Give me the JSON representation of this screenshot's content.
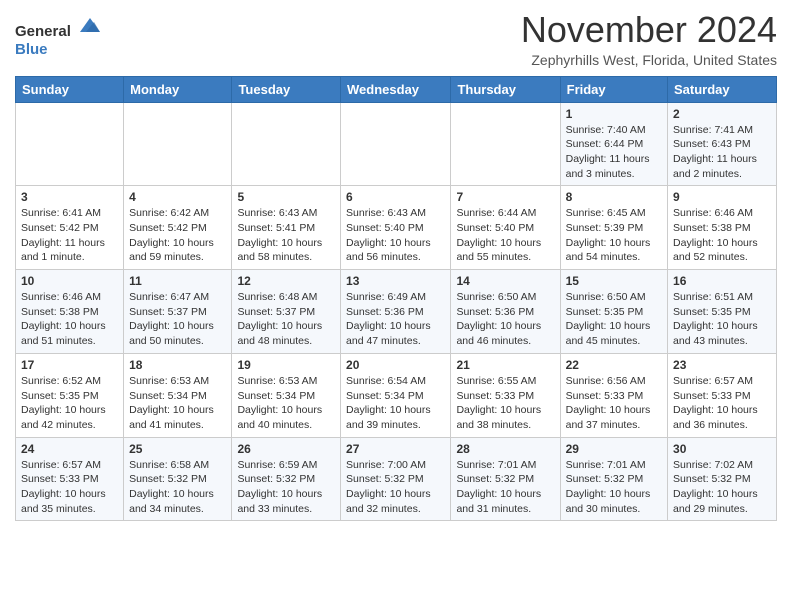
{
  "header": {
    "logo_general": "General",
    "logo_blue": "Blue",
    "month_title": "November 2024",
    "subtitle": "Zephyrhills West, Florida, United States"
  },
  "calendar": {
    "days_of_week": [
      "Sunday",
      "Monday",
      "Tuesday",
      "Wednesday",
      "Thursday",
      "Friday",
      "Saturday"
    ],
    "weeks": [
      [
        {
          "day": "",
          "content": ""
        },
        {
          "day": "",
          "content": ""
        },
        {
          "day": "",
          "content": ""
        },
        {
          "day": "",
          "content": ""
        },
        {
          "day": "",
          "content": ""
        },
        {
          "day": "1",
          "content": "Sunrise: 7:40 AM\nSunset: 6:44 PM\nDaylight: 11 hours and 3 minutes."
        },
        {
          "day": "2",
          "content": "Sunrise: 7:41 AM\nSunset: 6:43 PM\nDaylight: 11 hours and 2 minutes."
        }
      ],
      [
        {
          "day": "3",
          "content": "Sunrise: 6:41 AM\nSunset: 5:42 PM\nDaylight: 11 hours and 1 minute."
        },
        {
          "day": "4",
          "content": "Sunrise: 6:42 AM\nSunset: 5:42 PM\nDaylight: 10 hours and 59 minutes."
        },
        {
          "day": "5",
          "content": "Sunrise: 6:43 AM\nSunset: 5:41 PM\nDaylight: 10 hours and 58 minutes."
        },
        {
          "day": "6",
          "content": "Sunrise: 6:43 AM\nSunset: 5:40 PM\nDaylight: 10 hours and 56 minutes."
        },
        {
          "day": "7",
          "content": "Sunrise: 6:44 AM\nSunset: 5:40 PM\nDaylight: 10 hours and 55 minutes."
        },
        {
          "day": "8",
          "content": "Sunrise: 6:45 AM\nSunset: 5:39 PM\nDaylight: 10 hours and 54 minutes."
        },
        {
          "day": "9",
          "content": "Sunrise: 6:46 AM\nSunset: 5:38 PM\nDaylight: 10 hours and 52 minutes."
        }
      ],
      [
        {
          "day": "10",
          "content": "Sunrise: 6:46 AM\nSunset: 5:38 PM\nDaylight: 10 hours and 51 minutes."
        },
        {
          "day": "11",
          "content": "Sunrise: 6:47 AM\nSunset: 5:37 PM\nDaylight: 10 hours and 50 minutes."
        },
        {
          "day": "12",
          "content": "Sunrise: 6:48 AM\nSunset: 5:37 PM\nDaylight: 10 hours and 48 minutes."
        },
        {
          "day": "13",
          "content": "Sunrise: 6:49 AM\nSunset: 5:36 PM\nDaylight: 10 hours and 47 minutes."
        },
        {
          "day": "14",
          "content": "Sunrise: 6:50 AM\nSunset: 5:36 PM\nDaylight: 10 hours and 46 minutes."
        },
        {
          "day": "15",
          "content": "Sunrise: 6:50 AM\nSunset: 5:35 PM\nDaylight: 10 hours and 45 minutes."
        },
        {
          "day": "16",
          "content": "Sunrise: 6:51 AM\nSunset: 5:35 PM\nDaylight: 10 hours and 43 minutes."
        }
      ],
      [
        {
          "day": "17",
          "content": "Sunrise: 6:52 AM\nSunset: 5:35 PM\nDaylight: 10 hours and 42 minutes."
        },
        {
          "day": "18",
          "content": "Sunrise: 6:53 AM\nSunset: 5:34 PM\nDaylight: 10 hours and 41 minutes."
        },
        {
          "day": "19",
          "content": "Sunrise: 6:53 AM\nSunset: 5:34 PM\nDaylight: 10 hours and 40 minutes."
        },
        {
          "day": "20",
          "content": "Sunrise: 6:54 AM\nSunset: 5:34 PM\nDaylight: 10 hours and 39 minutes."
        },
        {
          "day": "21",
          "content": "Sunrise: 6:55 AM\nSunset: 5:33 PM\nDaylight: 10 hours and 38 minutes."
        },
        {
          "day": "22",
          "content": "Sunrise: 6:56 AM\nSunset: 5:33 PM\nDaylight: 10 hours and 37 minutes."
        },
        {
          "day": "23",
          "content": "Sunrise: 6:57 AM\nSunset: 5:33 PM\nDaylight: 10 hours and 36 minutes."
        }
      ],
      [
        {
          "day": "24",
          "content": "Sunrise: 6:57 AM\nSunset: 5:33 PM\nDaylight: 10 hours and 35 minutes."
        },
        {
          "day": "25",
          "content": "Sunrise: 6:58 AM\nSunset: 5:32 PM\nDaylight: 10 hours and 34 minutes."
        },
        {
          "day": "26",
          "content": "Sunrise: 6:59 AM\nSunset: 5:32 PM\nDaylight: 10 hours and 33 minutes."
        },
        {
          "day": "27",
          "content": "Sunrise: 7:00 AM\nSunset: 5:32 PM\nDaylight: 10 hours and 32 minutes."
        },
        {
          "day": "28",
          "content": "Sunrise: 7:01 AM\nSunset: 5:32 PM\nDaylight: 10 hours and 31 minutes."
        },
        {
          "day": "29",
          "content": "Sunrise: 7:01 AM\nSunset: 5:32 PM\nDaylight: 10 hours and 30 minutes."
        },
        {
          "day": "30",
          "content": "Sunrise: 7:02 AM\nSunset: 5:32 PM\nDaylight: 10 hours and 29 minutes."
        }
      ]
    ]
  }
}
